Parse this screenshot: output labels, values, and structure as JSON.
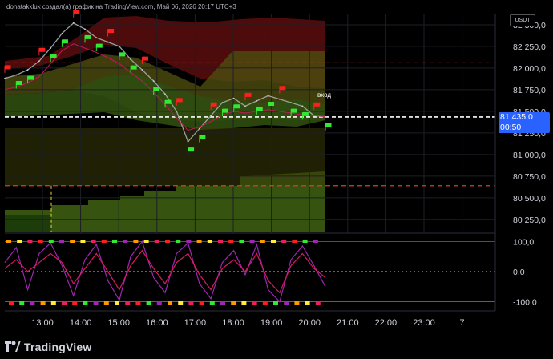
{
  "header": {
    "text": "donatakkluk создал(а) график на TradingView.com, Май 06, 2026 20:17 UTC+3"
  },
  "currency": "USDT",
  "price_tag": {
    "price": "81 435,0",
    "countdown": "00:50"
  },
  "entry_annotation": "вход",
  "brand": "TradingView",
  "colors": {
    "price_tag": "#2962ff",
    "band_red": "#8b1a1a",
    "band_green": "#3a5d12",
    "oscillator": "#c2185b",
    "oscillator2": "#9c27b0",
    "level_red": "#e03a2f",
    "level_green": "#00c853"
  },
  "chart_data": [
    {
      "type": "line",
      "pane": "price",
      "x_ticks": [
        "13:00",
        "14:00",
        "15:00",
        "16:00",
        "17:00",
        "18:00",
        "19:00",
        "20:00",
        "21:00",
        "22:00",
        "23:00",
        "7"
      ],
      "y_ticks": [
        "82 500,0",
        "82 250,0",
        "82 000,0",
        "81 750,0",
        "81 500,0",
        "81 250,0",
        "81 000,0",
        "80 750,0",
        "80 500,0",
        "80 250,0"
      ],
      "ylim": [
        80100,
        82620
      ],
      "series": [
        {
          "values": [
            81880,
            81920,
            81980,
            82080,
            82230,
            82400,
            82520,
            82450,
            82350,
            82300,
            82250,
            82100,
            81980,
            81850,
            81700,
            81500,
            81150,
            81300,
            81450,
            81600,
            81650,
            81560,
            81620,
            81680,
            81640,
            81600,
            81560,
            81450,
            81435
          ]
        },
        {
          "values": [
            81750,
            81780,
            81830,
            81900,
            82050,
            82200,
            82280,
            82230,
            82180,
            82120,
            82050,
            81950,
            81850,
            81720,
            81580,
            81420,
            81280,
            81320,
            81380,
            81460,
            81500,
            81480,
            81500,
            81520,
            81500,
            81480,
            81460,
            81450,
            81440
          ]
        }
      ],
      "levels": [
        {
          "value": 82060,
          "style": "dashed-red"
        },
        {
          "value": 81435,
          "style": "dashed-white"
        },
        {
          "value": 80640,
          "style": "dashed-red"
        }
      ]
    },
    {
      "type": "line",
      "pane": "oscillator",
      "y_ticks": [
        "100,0",
        "0,0",
        "-100,0"
      ],
      "ylim": [
        -125,
        125
      ],
      "series": [
        {
          "values": [
            30,
            80,
            -60,
            60,
            95,
            20,
            -80,
            40,
            90,
            -30,
            -95,
            50,
            100,
            -20,
            -70,
            60,
            95,
            -40,
            -90,
            30,
            70,
            -10,
            90,
            -60,
            -100,
            40,
            85,
            20,
            -50
          ]
        },
        {
          "values": [
            10,
            40,
            0,
            30,
            60,
            30,
            -40,
            10,
            60,
            0,
            -60,
            20,
            70,
            10,
            -40,
            30,
            60,
            -10,
            -60,
            10,
            40,
            0,
            60,
            -30,
            -70,
            20,
            60,
            10,
            -20
          ]
        }
      ],
      "levels": [
        {
          "value": 100,
          "style": "solid-red"
        },
        {
          "value": 0,
          "style": "dotted-white"
        },
        {
          "value": -100,
          "style": "solid-green"
        }
      ]
    }
  ]
}
